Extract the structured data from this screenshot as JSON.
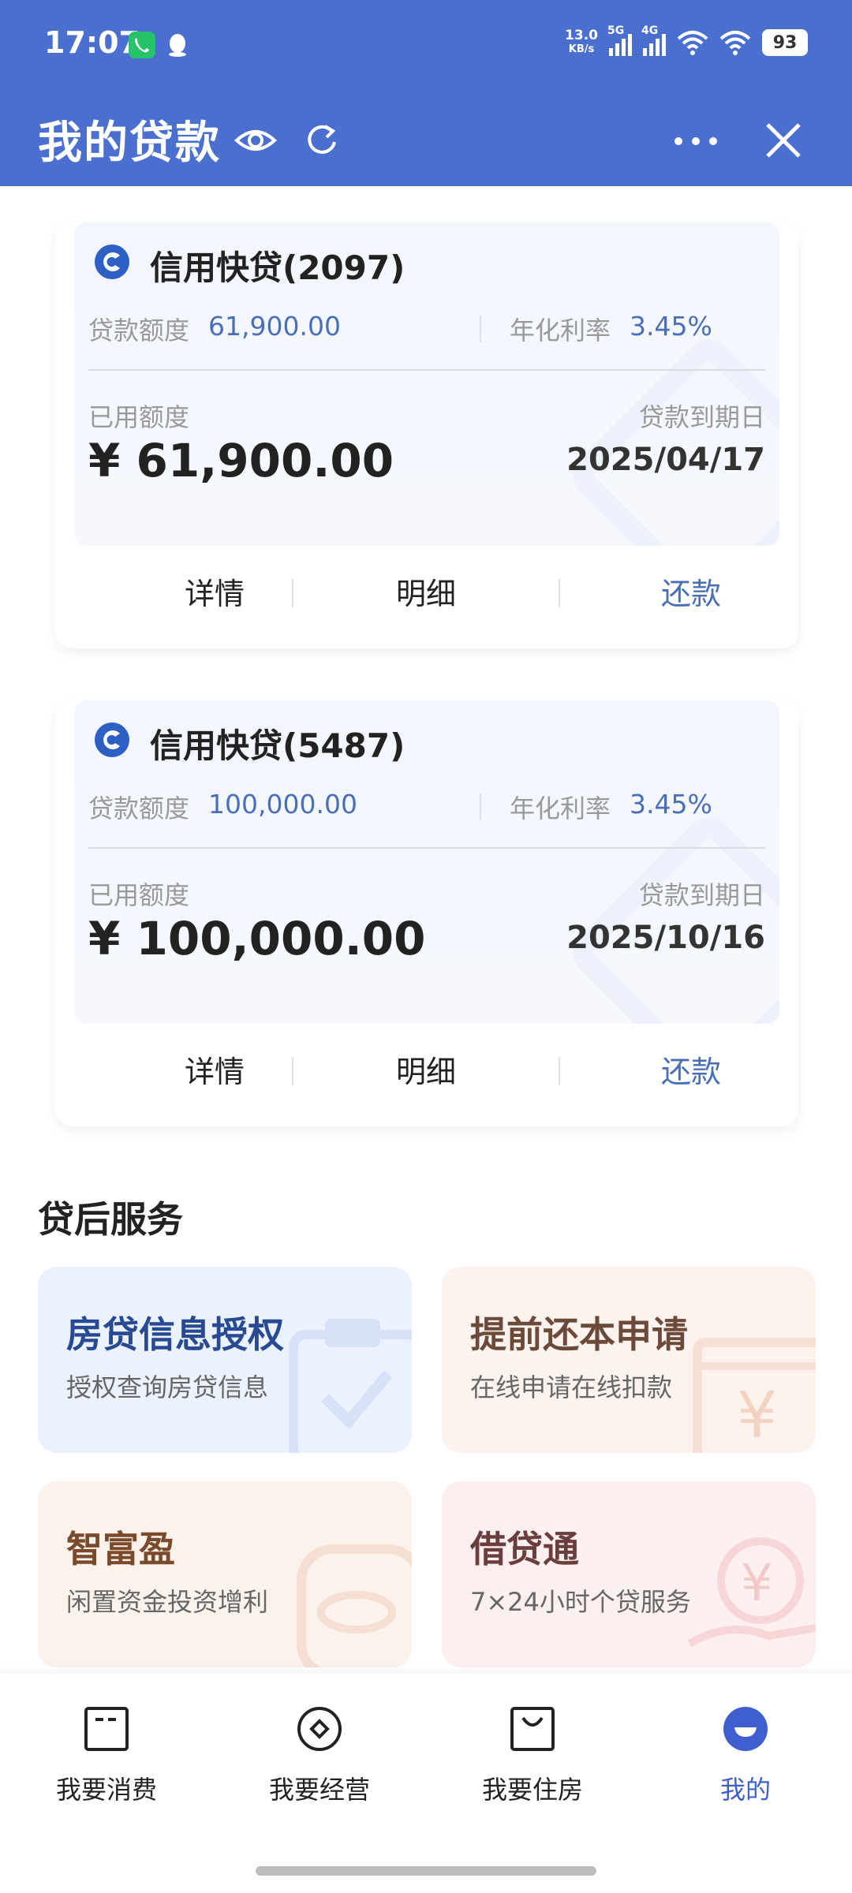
{
  "status_bar": {
    "time": "17:07",
    "net_speed_value": "13.0",
    "net_speed_unit": "KB/s",
    "signal1_label": "5G",
    "signal2_label": "4G",
    "battery": "93"
  },
  "header": {
    "title": "我的贷款",
    "icons": [
      "eye-icon",
      "refresh-icon",
      "more-icon",
      "close-icon"
    ],
    "background_color": "#4A6FCE"
  },
  "loans": [
    {
      "name": "信用快贷(2097)",
      "limit_label": "贷款额度",
      "limit_value": "61,900.00",
      "rate_label": "年化利率",
      "rate_value": "3.45%",
      "used_label": "已用额度",
      "used_amount": "¥ 61,900.00",
      "due_label": "贷款到期日",
      "due_date": "2025/04/17",
      "actions": {
        "details": "详情",
        "records": "明细",
        "repay": "还款"
      }
    },
    {
      "name": "信用快贷(5487)",
      "limit_label": "贷款额度",
      "limit_value": "100,000.00",
      "rate_label": "年化利率",
      "rate_value": "3.45%",
      "used_label": "已用额度",
      "used_amount": "¥ 100,000.00",
      "due_label": "贷款到期日",
      "due_date": "2025/10/16",
      "actions": {
        "details": "详情",
        "records": "明细",
        "repay": "还款"
      }
    }
  ],
  "services": {
    "title": "贷后服务",
    "items": [
      {
        "title": "房贷信息授权",
        "desc": "授权查询房贷信息"
      },
      {
        "title": "提前还本申请",
        "desc": "在线申请在线扣款"
      },
      {
        "title": "智富盈",
        "desc": "闲置资金投资增利"
      },
      {
        "title": "借贷通",
        "desc": "7×24小时个贷服务"
      }
    ]
  },
  "bottom_nav": {
    "items": [
      {
        "label": "我要消费",
        "icon": "wallet-icon"
      },
      {
        "label": "我要经营",
        "icon": "diamond-icon"
      },
      {
        "label": "我要住房",
        "icon": "bag-icon"
      },
      {
        "label": "我的",
        "icon": "profile-icon"
      }
    ],
    "active_index": 3,
    "active_color": "#3F5FCF"
  }
}
